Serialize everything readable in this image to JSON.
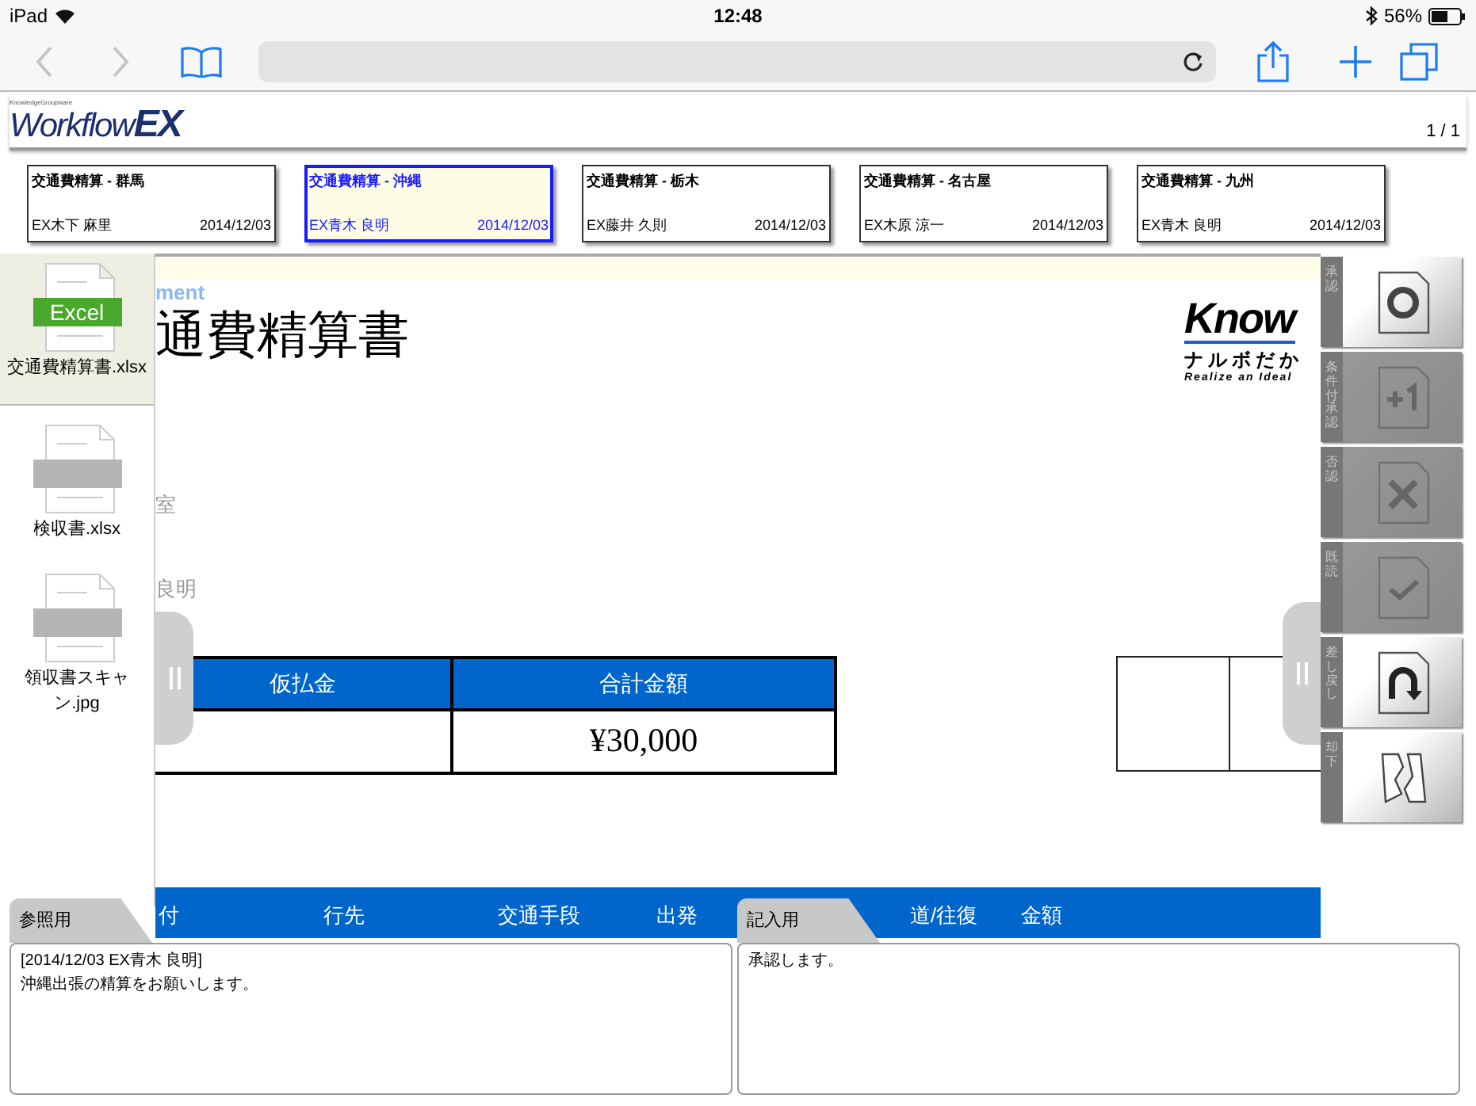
{
  "status_bar": {
    "device": "iPad",
    "time": "12:48",
    "battery": "56%"
  },
  "app_header": {
    "logo_tagline": "KnowledgeGroupware",
    "logo_main": "Workflow",
    "logo_suffix": "EX",
    "page_counter": "1 / 1"
  },
  "requests": [
    {
      "title": "交通費精算 - 群馬",
      "applicant": "EX木下 麻里",
      "date": "2014/12/03",
      "selected": false
    },
    {
      "title": "交通費精算 - 沖縄",
      "applicant": "EX青木 良明",
      "date": "2014/12/03",
      "selected": true
    },
    {
      "title": "交通費精算 - 栃木",
      "applicant": "EX藤井 久則",
      "date": "2014/12/03",
      "selected": false
    },
    {
      "title": "交通費精算 - 名古屋",
      "applicant": "EX木原 涼一",
      "date": "2014/12/03",
      "selected": false
    },
    {
      "title": "交通費精算 - 九州",
      "applicant": "EX青木 良明",
      "date": "2014/12/03",
      "selected": false
    }
  ],
  "attachments": [
    {
      "name": "交通費精算書.xlsx",
      "kind": "excel",
      "badge": "Excel",
      "selected": true
    },
    {
      "name": "検収書.xlsx",
      "kind": "generic",
      "selected": false
    },
    {
      "name": "領収書スキャン.jpg",
      "kind": "generic",
      "selected": false
    }
  ],
  "document": {
    "subtitle": "ment",
    "title": "通費精算書",
    "fields": [
      "室",
      "良明"
    ],
    "company_logo": {
      "name": "Know",
      "tagline_jp": "ナルボだか",
      "tagline_en": "Realize an Ideal"
    },
    "summary_table": {
      "columns": [
        "仮払金",
        "合計金額"
      ],
      "total": "¥30,000"
    },
    "detail_columns": [
      "付",
      "行先",
      "交通手段",
      "出発",
      "道/往復",
      "金額"
    ]
  },
  "actions": [
    {
      "label": "承認",
      "kind": "approve",
      "disabled": false
    },
    {
      "label": "条件付承認",
      "kind": "conditional",
      "disabled": true
    },
    {
      "label": "否認",
      "kind": "reject",
      "disabled": true
    },
    {
      "label": "既読",
      "kind": "read",
      "disabled": true
    },
    {
      "label": "差し戻し",
      "kind": "return",
      "disabled": false
    },
    {
      "label": "却下",
      "kind": "dismiss",
      "disabled": false
    }
  ],
  "memos": [
    {
      "tab": "参照用",
      "lines": [
        "[2014/12/03 EX青木 良明]",
        "沖縄出張の精算をお願いします。"
      ]
    },
    {
      "tab": "記入用",
      "lines": [
        "承認します。"
      ]
    }
  ]
}
